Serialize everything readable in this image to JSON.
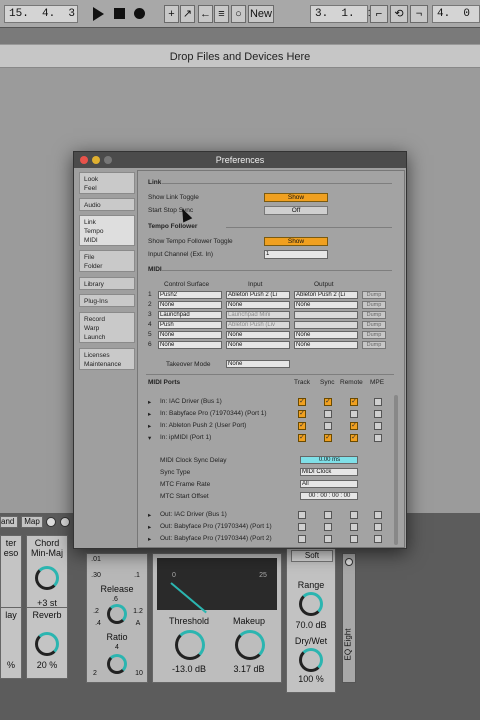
{
  "transport": {
    "bar_position": "15.  4.  3",
    "new_label": "New",
    "loop_start": "3.  1.  1",
    "loop_length": "4.  0"
  },
  "arrangement": {
    "drop_text": "Drop Files and Devices Here"
  },
  "devices": {
    "tabs": [
      "and",
      "Map"
    ],
    "chord_left": [
      "ter",
      "eso"
    ],
    "chord_title": [
      "Chord",
      "Min-Maj"
    ],
    "chord_value": "+3 st",
    "delay_label": "lay",
    "delay_value": "%",
    "reverb_label": "Reverb",
    "reverb_value": "20 %",
    "release_label": "Release",
    "ratio_label": "Ratio",
    "release_ticks": [
      ".01",
      ".30",
      ".1",
      ".6",
      ".2",
      "1.2",
      ".4",
      "A"
    ],
    "ratio_ticks": [
      "4",
      "2",
      "10"
    ],
    "meter_ticks": [
      "0",
      "25"
    ],
    "threshold_label": "Threshold",
    "threshold_value": "-13.0 dB",
    "makeup_label": "Makeup",
    "makeup_value": "3.17 dB",
    "soft_label": "Soft",
    "range_label": "Range",
    "range_value": "70.0 dB",
    "drywet_label": "Dry/Wet",
    "drywet_value": "100 %",
    "eq_label": "EQ Eight"
  },
  "prefs": {
    "title": "Preferences",
    "sidebar": [
      "Look\nFeel",
      "Audio",
      "Link\nTempo\nMIDI",
      "File\nFolder",
      "Library",
      "Plug-Ins",
      "Record\nWarp\nLaunch",
      "Licenses\nMaintenance"
    ],
    "link_section": "Link",
    "show_link_toggle": "Show Link Toggle",
    "show_link_value": "Show",
    "start_stop_sync": "Start Stop Sync",
    "start_stop_value": "Off",
    "tempo_section": "Tempo Follower",
    "show_tempo_toggle": "Show Tempo Follower Toggle",
    "show_tempo_value": "Show",
    "input_channel": "Input Channel (Ext. In)",
    "input_channel_value": "1",
    "midi_section": "MIDI",
    "col_control_surface": "Control Surface",
    "col_input": "Input",
    "col_output": "Output",
    "dump_label": "Dump",
    "surfaces": [
      {
        "n": "1",
        "cs": "Push2",
        "in": "Ableton Push 2 (Li",
        "out": "Ableton Push 2 (Li"
      },
      {
        "n": "2",
        "cs": "None",
        "in": "None",
        "out": "None"
      },
      {
        "n": "3",
        "cs": "Launchpad",
        "in": "Launchpad Mini",
        "out": ""
      },
      {
        "n": "4",
        "cs": "Push",
        "in": "Ableton Push (Liv",
        "out": ""
      },
      {
        "n": "5",
        "cs": "None",
        "in": "None",
        "out": "None"
      },
      {
        "n": "6",
        "cs": "None",
        "in": "None",
        "out": "None"
      }
    ],
    "takeover_label": "Takeover Mode",
    "takeover_value": "None",
    "midi_ports_label": "MIDI Ports",
    "col_track": "Track",
    "col_sync": "Sync",
    "col_remote": "Remote",
    "col_mpe": "MPE",
    "ports": [
      {
        "name": "In:  IAC Driver (Bus 1)",
        "track": true,
        "sync": true,
        "remote": true,
        "mpe": false
      },
      {
        "name": "In:  Babyface Pro (71970344) (Port 1)",
        "track": true,
        "sync": false,
        "remote": false,
        "mpe": false
      },
      {
        "name": "In:  Ableton Push 2 (User Port)",
        "track": true,
        "sync": false,
        "remote": true,
        "mpe": false
      },
      {
        "name": "In:  ipMIDI (Port 1)",
        "track": true,
        "sync": true,
        "remote": true,
        "mpe": false
      }
    ],
    "clock_sync_delay": "MIDI Clock Sync Delay",
    "clock_sync_value": "0.00 ms",
    "sync_type": "Sync Type",
    "sync_type_value": "MIDI Clock",
    "mtc_frame_rate": "MTC Frame Rate",
    "mtc_frame_value": "All",
    "mtc_start": "MTC Start Offset",
    "mtc_start_value": "00 : 00 : 00 : 00",
    "out_ports": [
      {
        "name": "Out: IAC Driver (Bus 1)"
      },
      {
        "name": "Out: Babyface Pro (71970344) (Port 1)"
      },
      {
        "name": "Out: Babyface Pro (71970344) (Port 2)"
      }
    ]
  },
  "colors": {
    "accent": "#f0a020",
    "teal": "#2bb5b0"
  }
}
